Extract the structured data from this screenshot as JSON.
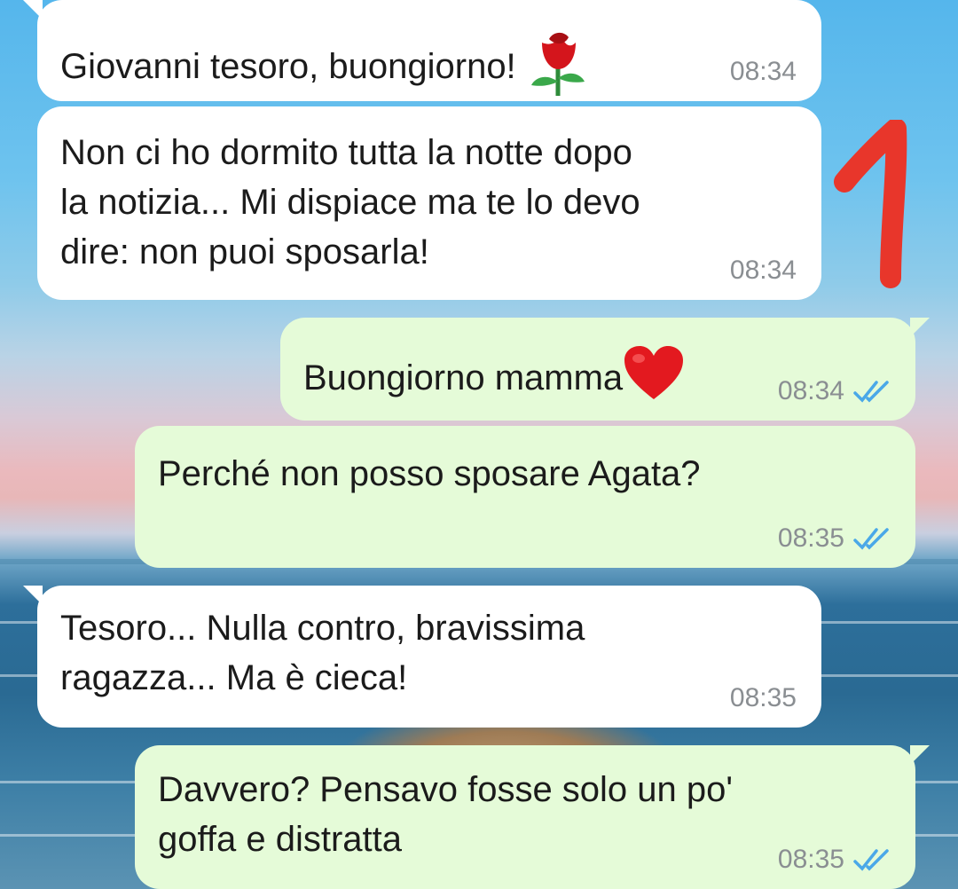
{
  "wallpaper": {
    "description_icons": [
      "sea-horizon",
      "dog-head"
    ],
    "colors": {
      "sky": "#55b6ec",
      "sunset": "#eab9bd",
      "sea": "#2d6f9b"
    }
  },
  "annotation": {
    "text": "1",
    "color": "#e8362b"
  },
  "theme": {
    "incoming_bubble": "#ffffff",
    "outgoing_bubble": "#e5fbd8",
    "timestamp_color": "#8a8e92",
    "read_ticks_color": "#4aa8e8"
  },
  "messages": [
    {
      "direction": "incoming",
      "text": "Giovanni tesoro, buongiorno!",
      "emoji": "rose",
      "time": "08:34"
    },
    {
      "direction": "incoming",
      "lines": [
        "Non ci ho dormito tutta la notte dopo",
        "la notizia... Mi dispiace ma te lo devo",
        "dire: non puoi sposarla!"
      ],
      "time": "08:34"
    },
    {
      "direction": "outgoing",
      "text": "Buongiorno mamma",
      "emoji": "red-heart",
      "time": "08:34",
      "status": "read"
    },
    {
      "direction": "outgoing",
      "text": "Perché non posso sposare Agata?",
      "time": "08:35",
      "status": "read"
    },
    {
      "direction": "incoming",
      "lines": [
        "Tesoro... Nulla contro, bravissima",
        "ragazza... Ma è cieca!"
      ],
      "time": "08:35"
    },
    {
      "direction": "outgoing",
      "lines": [
        "Davvero? Pensavo fosse solo un po'",
        "goffa e distratta"
      ],
      "time": "08:35",
      "status": "read"
    }
  ]
}
